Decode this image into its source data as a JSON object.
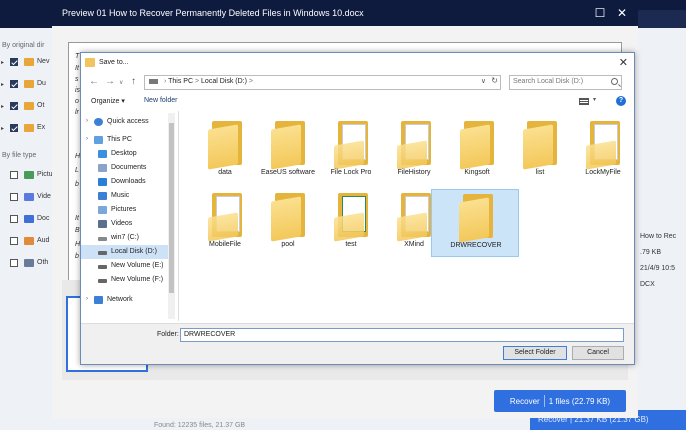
{
  "background": {
    "sidebar": {
      "by_original_label": "By original dir",
      "by_type_label": "By file type",
      "dir_items": [
        "Nev",
        "Du",
        "Ot",
        "Ex"
      ],
      "type_items": [
        "Pictu",
        "Vide",
        "Doc",
        "Aud",
        "Oth"
      ]
    },
    "right_panel": {
      "lines": [
        "How to Rec",
        ".79 KB",
        "21/4/9 10:5",
        "DCX"
      ]
    },
    "bottom_button": "Recover | 21.37 KB (21.37 GB)",
    "found_text": "Found: 12235 files, 21.37 GB"
  },
  "preview": {
    "title": "Preview 01 How to Recover Permanently Deleted Files in Windows 10.docx",
    "minimize_glyph": "☐",
    "close_glyph": "✕",
    "doc_lines": [
      "T",
      "It",
      "s",
      "is",
      "o",
      "lr",
      "H",
      "L",
      "b",
      "It",
      "B",
      "H",
      "b"
    ],
    "recover_label": "Recover",
    "recover_count": "1 files (22.79 KB)"
  },
  "dialog": {
    "title": "Save to...",
    "close_glyph": "✕",
    "address": {
      "parts": [
        "This PC",
        ">",
        "Local Disk (D:)",
        ">"
      ],
      "dropdown_glyph": "∨",
      "refresh_glyph": "↻"
    },
    "search_placeholder": "Search Local Disk (D:)",
    "toolbar": {
      "organize": "Organize ▾",
      "new_folder": "New folder"
    },
    "tree": [
      {
        "label": "Quick access",
        "icon": "star",
        "color": "#3b7fd6",
        "level": 0
      },
      {
        "label": "This PC",
        "icon": "pc",
        "color": "#5fa0e0",
        "level": 0
      },
      {
        "label": "Desktop",
        "icon": "desktop",
        "color": "#3b8fe0",
        "level": 1
      },
      {
        "label": "Documents",
        "icon": "documents",
        "color": "#8aa4c8",
        "level": 1
      },
      {
        "label": "Downloads",
        "icon": "downloads",
        "color": "#2a7fd6",
        "level": 1
      },
      {
        "label": "Music",
        "icon": "music",
        "color": "#3b7fd6",
        "level": 1
      },
      {
        "label": "Pictures",
        "icon": "pictures",
        "color": "#7aa8d8",
        "level": 1
      },
      {
        "label": "Videos",
        "icon": "videos",
        "color": "#5a6e8e",
        "level": 1
      },
      {
        "label": "win7 (C:)",
        "icon": "drive",
        "color": "#888888",
        "level": 1
      },
      {
        "label": "Local Disk (D:)",
        "icon": "drive",
        "color": "#666666",
        "level": 1,
        "selected": true
      },
      {
        "label": "New Volume (E:)",
        "icon": "drive",
        "color": "#666666",
        "level": 1
      },
      {
        "label": "New Volume (F:)",
        "icon": "drive",
        "color": "#666666",
        "level": 1
      },
      {
        "label": "Network",
        "icon": "network",
        "color": "#3b7fd6",
        "level": 0
      }
    ],
    "files": [
      {
        "name": "data",
        "kind": "folder"
      },
      {
        "name": "EaseUS software",
        "kind": "folder"
      },
      {
        "name": "File Lock Pro",
        "kind": "folder-gear"
      },
      {
        "name": "FileHistory",
        "kind": "folder-gear"
      },
      {
        "name": "Kingsoft",
        "kind": "folder"
      },
      {
        "name": "list",
        "kind": "folder"
      },
      {
        "name": "LockMyFile",
        "kind": "folder-doc"
      },
      {
        "name": "MobileFile",
        "kind": "folder-doc"
      },
      {
        "name": "pool",
        "kind": "folder"
      },
      {
        "name": "test",
        "kind": "folder-sheet"
      },
      {
        "name": "XMind",
        "kind": "folder-doc"
      },
      {
        "name": "DRWRECOVER",
        "kind": "folder",
        "selected": true
      }
    ],
    "folder_label": "Folder:",
    "folder_value": "DRWRECOVER",
    "select_button": "Select Folder",
    "cancel_button": "Cancel"
  }
}
